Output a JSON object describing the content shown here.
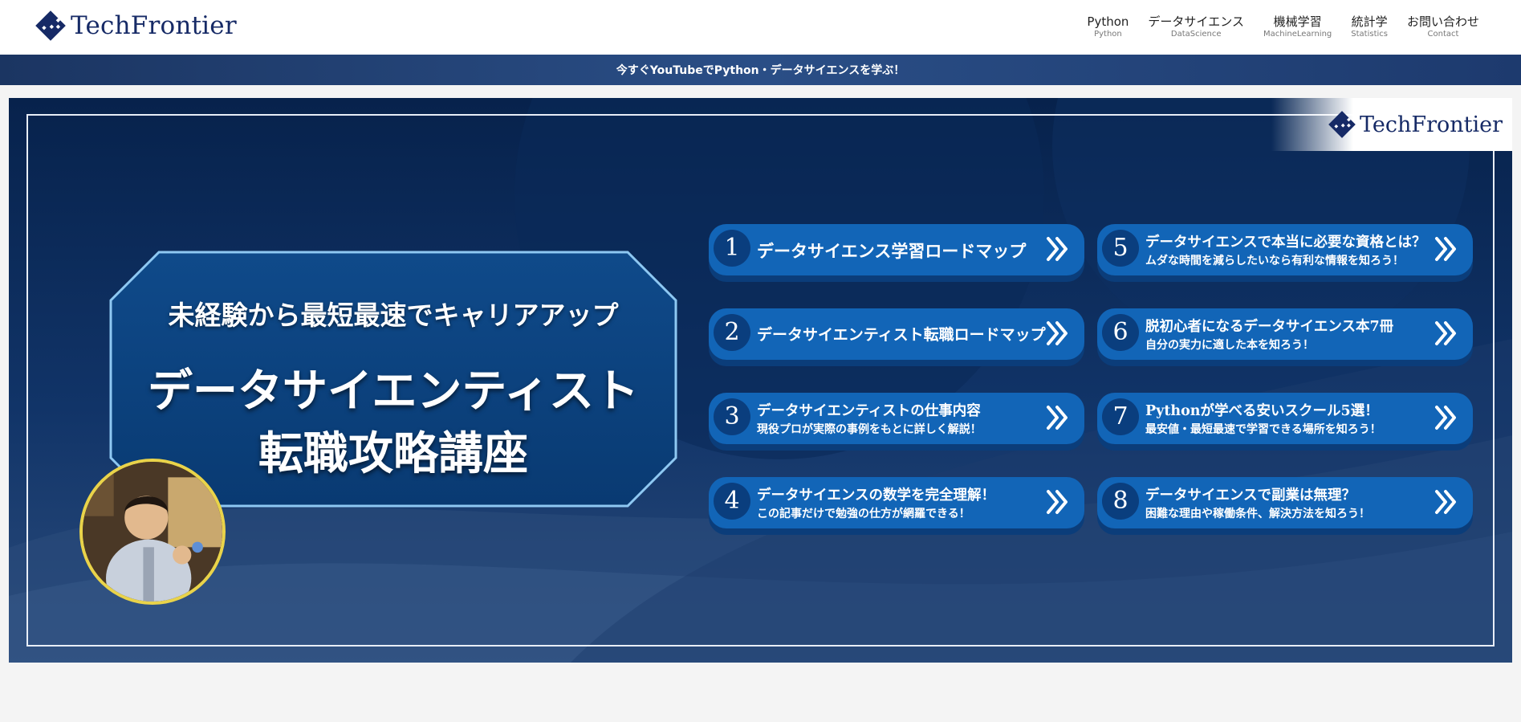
{
  "header": {
    "logo_text": "TechFrontier",
    "nav": [
      {
        "label": "Python",
        "sub": "Python"
      },
      {
        "label": "データサイエンス",
        "sub": "DataScience"
      },
      {
        "label": "機械学習",
        "sub": "MachineLearning"
      },
      {
        "label": "統計学",
        "sub": "Statistics"
      },
      {
        "label": "お問い合わせ",
        "sub": "Contact"
      }
    ]
  },
  "banner": {
    "text": "今すぐYouTubeでPython・データサイエンスを学ぶ！"
  },
  "hero": {
    "logo_text": "TechFrontier",
    "subtitle": "未経験から最短最速でキャリアアップ",
    "title_line1": "データサイエンティスト",
    "title_line2": "転職攻略講座",
    "buttons": [
      {
        "num": "1",
        "title": "データサイエンス学習ロードマップ",
        "desc": ""
      },
      {
        "num": "2",
        "title": "データサイエンティスト転職ロードマップ",
        "desc": ""
      },
      {
        "num": "3",
        "title": "データサイエンティストの仕事内容",
        "desc": "現役プロが実際の事例をもとに詳しく解説！"
      },
      {
        "num": "4",
        "title": "データサイエンスの数学を完全理解！",
        "desc": "この記事だけで勉強の仕方が網羅できる！"
      },
      {
        "num": "5",
        "title": "データサイエンスで本当に必要な資格とは？",
        "desc": "ムダな時間を減らしたいなら有利な情報を知ろう！"
      },
      {
        "num": "6",
        "title": "脱初心者になるデータサイエンス本7冊",
        "desc": "自分の実力に適した本を知ろう！"
      },
      {
        "num": "7",
        "title": "Pythonが学べる安いスクール5選！",
        "desc": "最安値・最短最速で学習できる場所を知ろう！"
      },
      {
        "num": "8",
        "title": "データサイエンスで副業は無理？",
        "desc": "困難な理由や稼働条件、解決方法を知ろう！"
      }
    ]
  },
  "colors": {
    "navy": "#162a66",
    "banner": "#2a4e86",
    "hero_bg": "#0c2a5a",
    "button": "#1265b7",
    "button_shadow": "#0b3d7a",
    "avatar_ring": "#e9d34a"
  },
  "icons": {
    "logo": "diamond-grid-icon",
    "button_arrow": "double-chevron-right-icon"
  }
}
